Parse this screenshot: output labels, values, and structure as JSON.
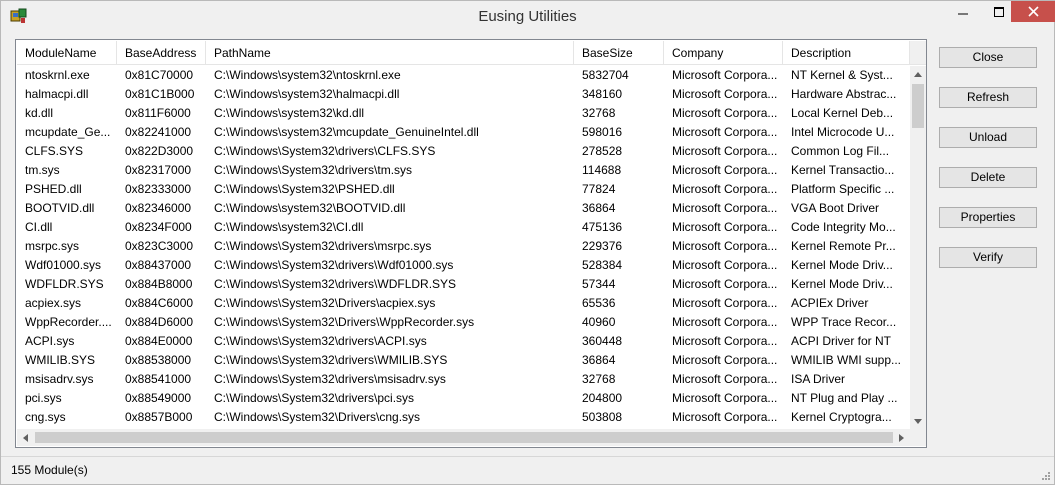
{
  "window": {
    "title": "Eusing Utilities"
  },
  "table": {
    "columns": [
      "ModuleName",
      "BaseAddress",
      "PathName",
      "BaseSize",
      "Company",
      "Description"
    ],
    "rows": [
      [
        "ntoskrnl.exe",
        "0x81C70000",
        "C:\\Windows\\system32\\ntoskrnl.exe",
        "5832704",
        "Microsoft Corpora...",
        "NT Kernel & Syst..."
      ],
      [
        "halmacpi.dll",
        "0x81C1B000",
        "C:\\Windows\\system32\\halmacpi.dll",
        "348160",
        "Microsoft Corpora...",
        "Hardware Abstrac..."
      ],
      [
        "kd.dll",
        "0x811F6000",
        "C:\\Windows\\system32\\kd.dll",
        "32768",
        "Microsoft Corpora...",
        "Local Kernel Deb..."
      ],
      [
        "mcupdate_Ge...",
        "0x82241000",
        "C:\\Windows\\system32\\mcupdate_GenuineIntel.dll",
        "598016",
        "Microsoft Corpora...",
        "Intel Microcode U..."
      ],
      [
        "CLFS.SYS",
        "0x822D3000",
        "C:\\Windows\\System32\\drivers\\CLFS.SYS",
        "278528",
        "Microsoft Corpora...",
        "Common Log Fil..."
      ],
      [
        "tm.sys",
        "0x82317000",
        "C:\\Windows\\System32\\drivers\\tm.sys",
        "114688",
        "Microsoft Corpora...",
        "Kernel Transactio..."
      ],
      [
        "PSHED.dll",
        "0x82333000",
        "C:\\Windows\\System32\\PSHED.dll",
        "77824",
        "Microsoft Corpora...",
        "Platform Specific ..."
      ],
      [
        "BOOTVID.dll",
        "0x82346000",
        "C:\\Windows\\system32\\BOOTVID.dll",
        "36864",
        "Microsoft Corpora...",
        "VGA Boot Driver"
      ],
      [
        "CI.dll",
        "0x8234F000",
        "C:\\Windows\\system32\\CI.dll",
        "475136",
        "Microsoft Corpora...",
        "Code Integrity Mo..."
      ],
      [
        "msrpc.sys",
        "0x823C3000",
        "C:\\Windows\\System32\\drivers\\msrpc.sys",
        "229376",
        "Microsoft Corpora...",
        "Kernel Remote Pr..."
      ],
      [
        "Wdf01000.sys",
        "0x88437000",
        "C:\\Windows\\System32\\drivers\\Wdf01000.sys",
        "528384",
        "Microsoft Corpora...",
        "Kernel Mode Driv..."
      ],
      [
        "WDFLDR.SYS",
        "0x884B8000",
        "C:\\Windows\\System32\\drivers\\WDFLDR.SYS",
        "57344",
        "Microsoft Corpora...",
        "Kernel Mode Driv..."
      ],
      [
        "acpiex.sys",
        "0x884C6000",
        "C:\\Windows\\System32\\Drivers\\acpiex.sys",
        "65536",
        "Microsoft Corpora...",
        "ACPIEx Driver"
      ],
      [
        "WppRecorder....",
        "0x884D6000",
        "C:\\Windows\\System32\\Drivers\\WppRecorder.sys",
        "40960",
        "Microsoft Corpora...",
        "WPP Trace Recor..."
      ],
      [
        "ACPI.sys",
        "0x884E0000",
        "C:\\Windows\\System32\\drivers\\ACPI.sys",
        "360448",
        "Microsoft Corpora...",
        "ACPI Driver for NT"
      ],
      [
        "WMILIB.SYS",
        "0x88538000",
        "C:\\Windows\\System32\\drivers\\WMILIB.SYS",
        "36864",
        "Microsoft Corpora...",
        "WMILIB WMI supp..."
      ],
      [
        "msisadrv.sys",
        "0x88541000",
        "C:\\Windows\\System32\\drivers\\msisadrv.sys",
        "32768",
        "Microsoft Corpora...",
        "ISA Driver"
      ],
      [
        "pci.sys",
        "0x88549000",
        "C:\\Windows\\System32\\drivers\\pci.sys",
        "204800",
        "Microsoft Corpora...",
        "NT Plug and Play ..."
      ],
      [
        "cng.sys",
        "0x8857B000",
        "C:\\Windows\\System32\\Drivers\\cng.sys",
        "503808",
        "Microsoft Corpora...",
        "Kernel Cryptogra..."
      ]
    ]
  },
  "buttons": {
    "close": "Close",
    "refresh": "Refresh",
    "unload": "Unload",
    "delete": "Delete",
    "properties": "Properties",
    "verify": "Verify"
  },
  "status": {
    "text": "155 Module(s)"
  },
  "colors": {
    "close_button": "#c7504b",
    "list_border": "#828790",
    "scroll_thumb": "#cdcdcd"
  },
  "icons": {
    "app": "app-icon",
    "minimize": "minimize-icon",
    "maximize": "maximize-icon",
    "close": "close-icon"
  }
}
